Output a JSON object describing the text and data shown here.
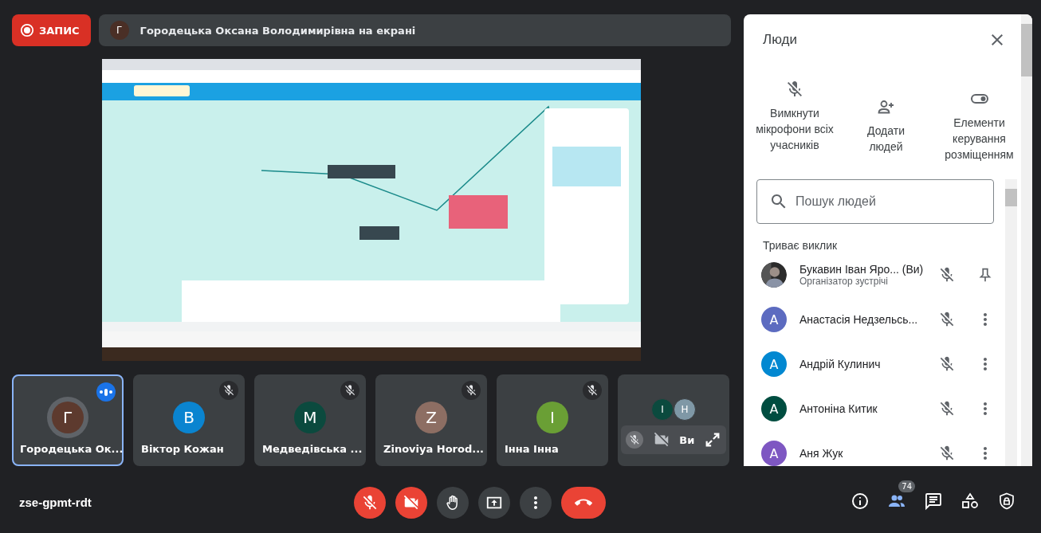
{
  "recording": {
    "label": "ЗАПИС"
  },
  "presenter_banner": {
    "initial": "Г",
    "text": "Городецька Оксана Володимирівна на екрані"
  },
  "tiles": [
    {
      "name": "Городецька Ок...",
      "initial": "Г",
      "color": "#5d3a2e",
      "selected": true,
      "speaking": true,
      "muted": false
    },
    {
      "name": "Віктор Кожан",
      "initial": "В",
      "color": "#0a84d0",
      "selected": false,
      "speaking": false,
      "muted": true
    },
    {
      "name": "Медведівська ...",
      "initial": "М",
      "color": "#0b4a3e",
      "selected": false,
      "speaking": false,
      "muted": true
    },
    {
      "name": "Zinoviya Horod...",
      "initial": "Z",
      "color": "#8d6e63",
      "selected": false,
      "speaking": false,
      "muted": true
    },
    {
      "name": "Інна Інна",
      "initial": "І",
      "color": "#6a9f35",
      "selected": false,
      "speaking": false,
      "muted": true
    }
  ],
  "self_tile": {
    "others": [
      {
        "initial": "І",
        "color": "#0b4a3e"
      },
      {
        "initial": "Н",
        "color": "#7f98a6"
      }
    ],
    "label": "Ви"
  },
  "people_panel": {
    "title": "Люди",
    "actions": [
      {
        "kind": "mute-all",
        "label": "Вимкнути мікрофони всіх учасників"
      },
      {
        "kind": "add",
        "label": "Додати людей"
      },
      {
        "kind": "host",
        "label": "Елементи керування розміщенням"
      }
    ],
    "search": {
      "placeholder": "Пошук людей"
    },
    "section": "Триває виклик",
    "participants": [
      {
        "kind": "host",
        "name": "Букавин Іван Яро... (Ви)",
        "role": "Організатор зустрічі"
      },
      {
        "kind": "guest",
        "name": "Анастасія Недзельсь...",
        "initial": "А",
        "color": "#5c6bc0"
      },
      {
        "kind": "guest",
        "name": "Андрій Кулинич",
        "initial": "А",
        "color": "#0288d1"
      },
      {
        "kind": "guest",
        "name": "Антоніна Китик",
        "initial": "А",
        "color": "#004d40"
      },
      {
        "kind": "guest",
        "name": "Аня Жук",
        "initial": "А",
        "color": "#7e57c2"
      }
    ]
  },
  "meeting_code": "zse-gpmt-rdt",
  "controls": [
    {
      "kind": "mic",
      "on": false
    },
    {
      "kind": "camera",
      "on": false
    },
    {
      "kind": "hand"
    },
    {
      "kind": "present"
    },
    {
      "kind": "more"
    },
    {
      "kind": "leave"
    }
  ],
  "side_buttons": [
    {
      "kind": "info",
      "selected": false
    },
    {
      "kind": "people",
      "selected": true,
      "badge": "74"
    },
    {
      "kind": "chat",
      "selected": false
    },
    {
      "kind": "activities",
      "selected": false
    },
    {
      "kind": "safety",
      "selected": false
    }
  ]
}
